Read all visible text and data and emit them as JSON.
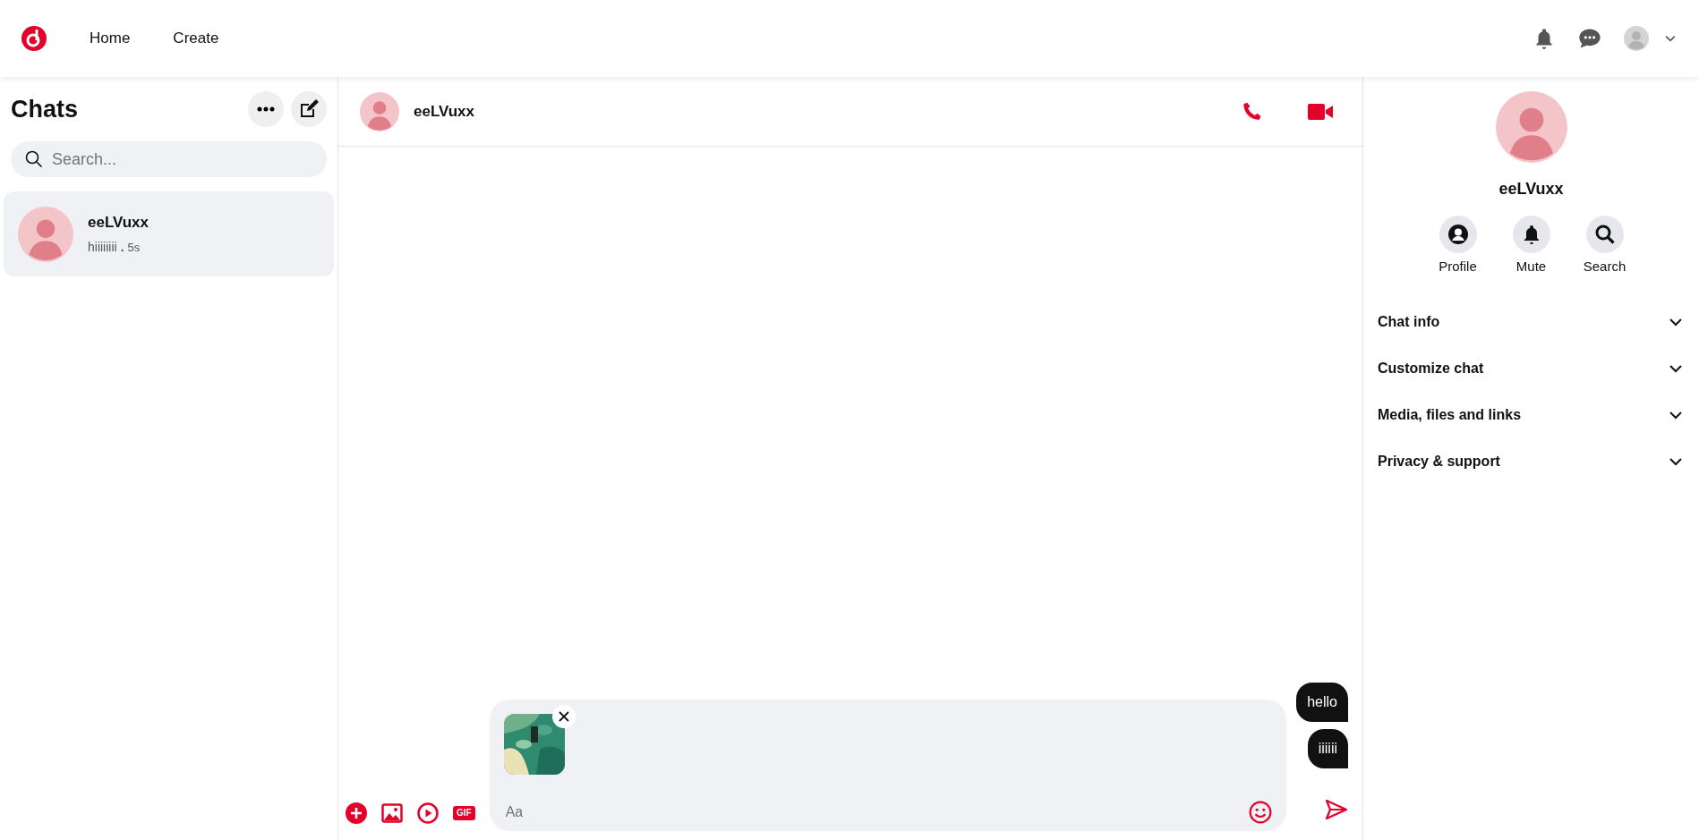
{
  "nav": {
    "links": [
      {
        "label": "Home"
      },
      {
        "label": "Create"
      }
    ]
  },
  "sidebar": {
    "title": "Chats",
    "search": {
      "placeholder": "Search..."
    },
    "chats": [
      {
        "name": "eeLVuxx",
        "preview": "hiiiiiiii",
        "separator": ".",
        "time": "5s",
        "selected": true
      }
    ]
  },
  "conversation": {
    "name": "eeLVuxx",
    "messages": [
      {
        "text": "hello"
      },
      {
        "text": "iiiiii"
      }
    ],
    "composer": {
      "placeholder": "Aa",
      "gif_label": "GIF"
    }
  },
  "details": {
    "name": "eeLVuxx",
    "actions": [
      {
        "label": "Profile",
        "kind": "profile"
      },
      {
        "label": "Mute",
        "kind": "mute"
      },
      {
        "label": "Search",
        "kind": "search"
      }
    ],
    "sections": [
      {
        "label": "Chat info",
        "expanded": false
      },
      {
        "label": "Customize chat",
        "expanded": false
      },
      {
        "label": "Media, files and links",
        "expanded": false
      },
      {
        "label": "Privacy & support",
        "expanded": false
      }
    ]
  }
}
